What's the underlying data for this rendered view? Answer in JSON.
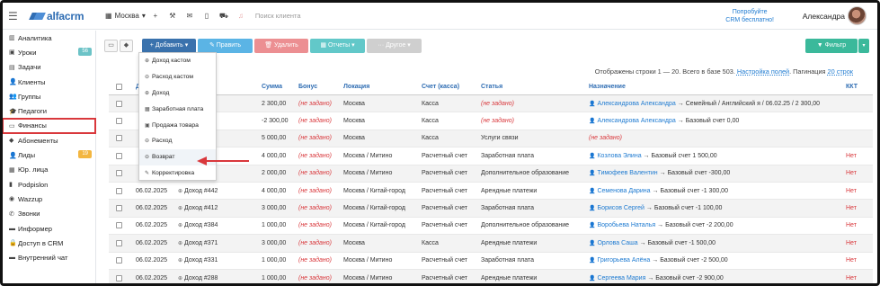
{
  "header": {
    "logo_text": "alfacrm",
    "branch": "Москва",
    "search_placeholder": "Поиск клиента",
    "try_crm_line1": "Попробуйте",
    "try_crm_line2": "CRM бесплатно!",
    "user_name": "Александра",
    "icons": [
      "menu-icon",
      "building-icon",
      "plus-icon",
      "wrench-icon",
      "mail-icon",
      "phone-icon",
      "cart-icon",
      "bell-icon"
    ]
  },
  "sidebar": {
    "items": [
      {
        "label": "Аналитика",
        "icon": "chart-icon"
      },
      {
        "label": "Уроки",
        "icon": "calendar-icon",
        "badge": "56"
      },
      {
        "label": "Задачи",
        "icon": "tasks-icon"
      },
      {
        "label": "Клиенты",
        "icon": "user-icon"
      },
      {
        "label": "Группы",
        "icon": "users-icon"
      },
      {
        "label": "Педагоги",
        "icon": "teacher-icon"
      },
      {
        "label": "Финансы",
        "icon": "money-icon"
      },
      {
        "label": "Абонементы",
        "icon": "tag-icon"
      },
      {
        "label": "Лиды",
        "icon": "lead-icon",
        "badge": "19"
      },
      {
        "label": "Юр. лица",
        "icon": "building-icon"
      },
      {
        "label": "Podpislon",
        "icon": "doc-icon"
      },
      {
        "label": "Wazzup",
        "icon": "chat-icon"
      },
      {
        "label": "Звонки",
        "icon": "phone-icon"
      },
      {
        "label": "Информер",
        "icon": "info-icon"
      },
      {
        "label": "Доступ в CRM",
        "icon": "lock-icon"
      },
      {
        "label": "Внутренний чат",
        "icon": "message-icon"
      }
    ]
  },
  "toolbar": {
    "add": "+ Добавить ▾",
    "edit": "✎ Править",
    "delete": "🗑 Удалить",
    "reports": "▦ Отчеты ▾",
    "other": "··· Другое ▾",
    "filter": "▼ Фильтр",
    "filter_caret": "▾"
  },
  "info": {
    "shown": "Отображены строки 1 — 20. Всего в базе 503.",
    "fields_link": "Настройка полей",
    "pagination_label": "Пагинация",
    "pagination_value": "20 строк"
  },
  "dropdown": {
    "items": [
      {
        "label": "Доход кастом",
        "icon": "⊕"
      },
      {
        "label": "Расход кастом",
        "icon": "⊖"
      },
      {
        "label": "Доход",
        "icon": "⊕"
      },
      {
        "label": "Заработная плата",
        "icon": "▦"
      },
      {
        "label": "Продажа товара",
        "icon": "▣"
      },
      {
        "label": "Расход",
        "icon": "⊖"
      },
      {
        "label": "Возврат",
        "icon": "⊖"
      },
      {
        "label": "Корректировка",
        "icon": "✎"
      }
    ]
  },
  "table": {
    "columns": {
      "date": "Д",
      "name": "ни",
      "sum": "Сумма",
      "bonus": "Бонус",
      "location": "Локация",
      "account": "Счет (касса)",
      "article": "Статья",
      "destination": "Назначение",
      "kkt": "ККТ"
    },
    "rows": [
      {
        "date": "",
        "name": "ход #503",
        "sum": "2 300,00",
        "bonus": "(не задано)",
        "location": "Москва",
        "account": "Касса",
        "article": "(не задано)",
        "article_red": true,
        "dest_person": "Александрова Александра",
        "dest_rest": "→ Семейный / Английский я / 06.02.25 / 2 300,00",
        "kkt": ""
      },
      {
        "date": "",
        "name": "ход #502",
        "sum": "-2 300,00",
        "bonus": "(не задано)",
        "location": "Москва",
        "account": "Касса",
        "article": "(не задано)",
        "article_red": true,
        "dest_person": "Александрова Александра",
        "dest_rest": "→ Базовый счет 0,00",
        "kkt": ""
      },
      {
        "date": "",
        "name": "",
        "sum": "5 000,00",
        "bonus": "(не задано)",
        "location": "Москва",
        "account": "Касса",
        "article": "Услуги связи",
        "article_red": false,
        "dest_person": "",
        "dest_rest": "(не задано)",
        "dest_red": true,
        "kkt": ""
      },
      {
        "date": "",
        "name": "",
        "sum": "4 000,00",
        "bonus": "(не задано)",
        "location": "Москва / Митино",
        "account": "Расчетный счет",
        "article": "Заработная плата",
        "article_red": false,
        "dest_person": "Козлова Элина",
        "dest_rest": "→ Базовый счет 1 500,00",
        "kkt": "Нет"
      },
      {
        "date": "",
        "name": "",
        "sum": "2 000,00",
        "bonus": "(не задано)",
        "location": "Москва / Митино",
        "account": "Расчетный счет",
        "article": "Дополнительное образование",
        "article_red": false,
        "dest_person": "Тимофеев Валентин",
        "dest_rest": "→ Базовый счет -300,00",
        "kkt": "Нет"
      },
      {
        "date": "06.02.2025",
        "name": "Доход #442",
        "sum": "4 000,00",
        "bonus": "(не задано)",
        "location": "Москва / Китай-город",
        "account": "Расчетный счет",
        "article": "Арендные платежи",
        "article_red": false,
        "dest_person": "Семенова Дарина",
        "dest_rest": "→ Базовый счет -1 300,00",
        "kkt": "Нет"
      },
      {
        "date": "06.02.2025",
        "name": "Доход #412",
        "sum": "3 000,00",
        "bonus": "(не задано)",
        "location": "Москва / Китай-город",
        "account": "Расчетный счет",
        "article": "Заработная плата",
        "article_red": false,
        "dest_person": "Борисов Сергей",
        "dest_rest": "→ Базовый счет -1 100,00",
        "kkt": "Нет"
      },
      {
        "date": "06.02.2025",
        "name": "Доход #384",
        "sum": "1 000,00",
        "bonus": "(не задано)",
        "location": "Москва / Китай-город",
        "account": "Расчетный счет",
        "article": "Дополнительное образование",
        "article_red": false,
        "dest_person": "Воробьева Наталья",
        "dest_rest": "→ Базовый счет -2 200,00",
        "kkt": "Нет"
      },
      {
        "date": "06.02.2025",
        "name": "Доход #371",
        "sum": "3 000,00",
        "bonus": "(не задано)",
        "location": "Москва",
        "account": "Касса",
        "article": "Арендные платежи",
        "article_red": false,
        "dest_person": "Орлова Саша",
        "dest_rest": "→ Базовый счет -1 500,00",
        "kkt": "Нет"
      },
      {
        "date": "06.02.2025",
        "name": "Доход #331",
        "sum": "1 000,00",
        "bonus": "(не задано)",
        "location": "Москва / Митино",
        "account": "Расчетный счет",
        "article": "Заработная плата",
        "article_red": false,
        "dest_person": "Григорьева Алёна",
        "dest_rest": "→ Базовый счет -2 500,00",
        "kkt": "Нет"
      },
      {
        "date": "06.02.2025",
        "name": "Доход #288",
        "sum": "1 000,00",
        "bonus": "(не задано)",
        "location": "Москва / Митино",
        "account": "Расчетный счет",
        "article": "Арендные платежи",
        "article_red": false,
        "dest_person": "Сергеева Мария",
        "dest_rest": "→ Базовый счет -2 900,00",
        "kkt": "Нет"
      }
    ]
  }
}
